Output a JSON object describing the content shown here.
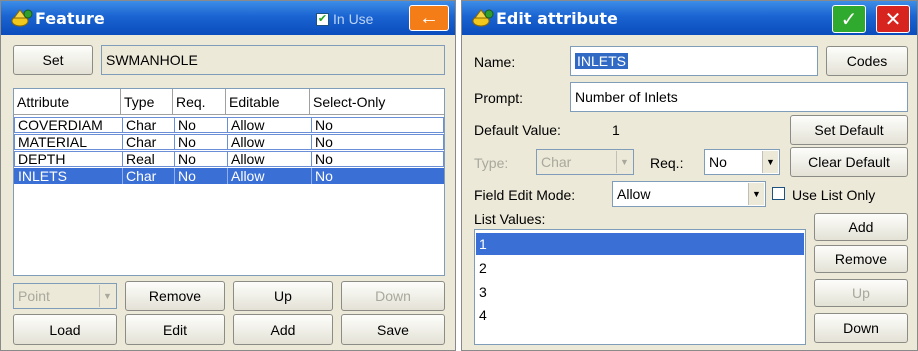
{
  "feature_window": {
    "title": "Feature",
    "in_use_label": "In Use",
    "in_use_checked": true,
    "back_icon": "arrow-left-icon",
    "set_button": "Set",
    "set_value": "SWMANHOLE",
    "table": {
      "headers": [
        "Attribute",
        "Type",
        "Req.",
        "Editable",
        "Select-Only"
      ],
      "rows": [
        [
          "COVERDIAM",
          "Char",
          "No",
          "Allow",
          "No"
        ],
        [
          "MATERIAL",
          "Char",
          "No",
          "Allow",
          "No"
        ],
        [
          "DEPTH",
          "Real",
          "No",
          "Allow",
          "No"
        ],
        [
          "INLETS",
          "Char",
          "No",
          "Allow",
          "No"
        ]
      ],
      "selected_row": 3
    },
    "point_combo": "Point",
    "buttons": {
      "remove": "Remove",
      "up": "Up",
      "down": "Down",
      "load": "Load",
      "edit": "Edit",
      "add": "Add",
      "save": "Save"
    }
  },
  "edit_window": {
    "title": "Edit attribute",
    "ok_icon": "checkmark-icon",
    "close_icon": "close-icon",
    "name_label": "Name:",
    "name_value": "INLETS",
    "codes_button": "Codes",
    "prompt_label": "Prompt:",
    "prompt_value": "Number of Inlets",
    "default_value_label": "Default Value:",
    "default_value": "1",
    "set_default_button": "Set Default",
    "type_label": "Type:",
    "type_value": "Char",
    "req_label": "Req.:",
    "req_value": "No",
    "clear_default_button": "Clear Default",
    "field_edit_mode_label": "Field Edit Mode:",
    "field_edit_mode_value": "Allow",
    "use_list_only_label": "Use List Only",
    "use_list_only_checked": false,
    "list_values_label": "List Values:",
    "list_values": [
      "1",
      "2",
      "3",
      "4"
    ],
    "selected_list_value": 0,
    "buttons": {
      "add": "Add",
      "remove": "Remove",
      "up": "Up",
      "down": "Down"
    }
  },
  "colors": {
    "title_gradient_top": "#3d8de6",
    "title_gradient_bottom": "#0b4cbc",
    "selection": "#3a6fd6",
    "back_button": "#f47d17",
    "ok_button": "#2faa2f",
    "close_button": "#d8241f",
    "window_bg": "#ece9d8"
  }
}
